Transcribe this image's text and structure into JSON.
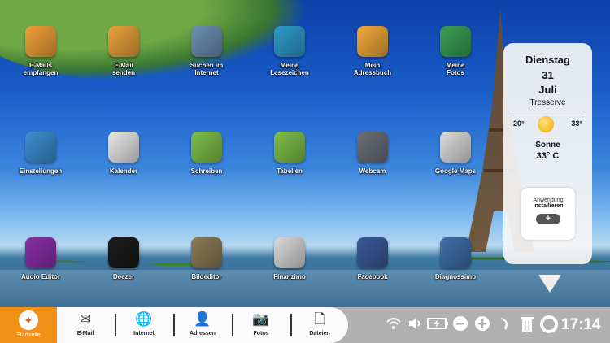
{
  "desktop": {
    "apps_row1": [
      {
        "label": "E-Mails\nempfangen",
        "icon": "inbox-tray-icon",
        "color": "#f0a13a"
      },
      {
        "label": "E-Mail\nsenden",
        "icon": "envelope-send-icon",
        "color": "#e9a23c"
      },
      {
        "label": "Suchen im\nInternet",
        "icon": "globe-www-icon",
        "color": "#6d8fb3"
      },
      {
        "label": "Meine\nLesezeichen",
        "icon": "atom-bookmark-icon",
        "color": "#2f9bc9"
      },
      {
        "label": "Mein\nAdressbuch",
        "icon": "address-book-icon",
        "color": "#f1a83a"
      },
      {
        "label": "Meine\nFotos",
        "icon": "photos-icon",
        "color": "#3a9f56"
      }
    ],
    "apps_row2": [
      {
        "label": "Einstellungen",
        "icon": "wrench-hammer-icon",
        "color": "#3c8fd0"
      },
      {
        "label": "Kalender",
        "icon": "calendar-icon",
        "color": "#e8e8e8"
      },
      {
        "label": "Schreiben",
        "icon": "document-write-icon",
        "color": "#7fbf4a"
      },
      {
        "label": "Tabellen",
        "icon": "spreadsheet-icon",
        "color": "#7fbf4a"
      },
      {
        "label": "Webcam",
        "icon": "webcam-icon",
        "color": "#6a6f78"
      },
      {
        "label": "Google Maps",
        "icon": "google-maps-icon",
        "color": "#dcdcdc"
      }
    ],
    "apps_row3": [
      {
        "label": "Audio Editor",
        "icon": "headphones-icon",
        "color": "#8a2fa6"
      },
      {
        "label": "Deezer",
        "icon": "equalizer-icon",
        "color": "#1b1b1b"
      },
      {
        "label": "Bildeditor",
        "icon": "gimp-icon",
        "color": "#8c7a55"
      },
      {
        "label": "Finanzimo",
        "icon": "finance-document-icon",
        "color": "#d9d9d9"
      },
      {
        "label": "Facebook",
        "icon": "facebook-icon",
        "color": "#3b5998"
      },
      {
        "label": "Diagnossimo",
        "icon": "diagnostic-monitor-icon",
        "color": "#3f6fa8"
      }
    ]
  },
  "weather": {
    "day": "Dienstag",
    "date": "31",
    "month": "Juli",
    "location": "Tresserve",
    "temp_low": "20°",
    "temp_high": "33°",
    "condition": "Sonne",
    "current_temp": "33° C",
    "install_label_1": "Anwendung",
    "install_label_2": "installieren",
    "install_plus": "+"
  },
  "taskbar": {
    "home_label": "Startseite",
    "home_accent": "#f29118",
    "nav": [
      {
        "label": "E-Mail",
        "icon": "envelope-icon",
        "glyph": "✉"
      },
      {
        "label": "Internet",
        "icon": "globe-icon",
        "glyph": "🌐"
      },
      {
        "label": "Adressen",
        "icon": "contacts-icon",
        "glyph": "👤"
      },
      {
        "label": "Fotos",
        "icon": "camera-icon",
        "glyph": "📷"
      },
      {
        "label": "Dateien",
        "icon": "files-icon",
        "glyph": "🗋"
      }
    ],
    "tray": {
      "wifi": "wifi-icon",
      "volume": "volume-icon",
      "battery": "battery-charging-icon",
      "zoom_out": "zoom-out-icon",
      "zoom_in": "zoom-in-icon",
      "back": "back-arrow-icon",
      "trash": "trash-icon",
      "help": "lifebuoy-icon"
    },
    "clock": "17:14"
  }
}
